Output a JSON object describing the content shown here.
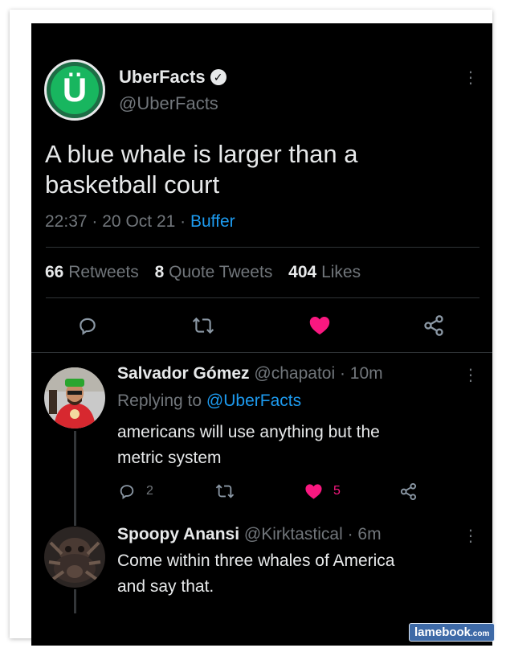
{
  "tweet": {
    "name": "UberFacts",
    "handle": "@UberFacts",
    "text_line1": "A blue whale is larger than a",
    "text_line2": "basketball court",
    "time": "22:37",
    "sep1": "·",
    "date": "20 Oct 21",
    "sep2": "·",
    "source": "Buffer",
    "retweets_count": "66",
    "retweets_label": "Retweets",
    "quotes_count": "8",
    "quotes_label": "Quote Tweets",
    "likes_count": "404",
    "likes_label": "Likes",
    "avatar_letter": "Ü"
  },
  "replies": [
    {
      "name": "Salvador Gómez",
      "handle": "@chapatoi",
      "time": "· 10m",
      "replying_prefix": "Replying to",
      "replying_to": "@UberFacts",
      "text_line1": "americans will use anything but the",
      "text_line2": "metric system",
      "reply_count": "2",
      "like_count": "5"
    },
    {
      "name": "Spoopy Anansi",
      "handle": "@Kirktastical",
      "time": "· 6m",
      "text_line1": "Come within three whales of America",
      "text_line2": "and say that."
    }
  ],
  "more_glyph": "⋮",
  "watermark": {
    "main": "lamebook",
    "suffix": ".com"
  },
  "colors": {
    "background": "#000000",
    "text": "#e7e9ea",
    "muted": "#71767b",
    "accent_blue": "#1d9bf0",
    "like_pink": "#f91880"
  },
  "icons": [
    "reply-icon",
    "retweet-icon",
    "heart-icon",
    "share-icon",
    "more-icon",
    "verified-icon"
  ]
}
